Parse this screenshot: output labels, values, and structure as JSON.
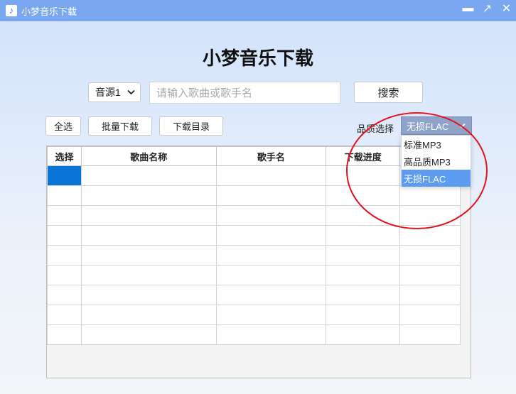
{
  "window": {
    "title": "小梦音乐下载",
    "controls": [
      "▬",
      "↗",
      "✕"
    ]
  },
  "heading": "小梦音乐下载",
  "search": {
    "source_selected": "音源1",
    "placeholder": "请输入歌曲或歌手名",
    "button": "搜索"
  },
  "toolbar": {
    "select_all": "全选",
    "batch_download": "批量下载",
    "download_dir": "下载目录",
    "quality_label": "品质选择",
    "quality_selected": "无损FLAC",
    "quality_options": [
      "标准MP3",
      "高品质MP3",
      "无损FLAC"
    ]
  },
  "table": {
    "columns": [
      "选择",
      "歌曲名称",
      "歌手名",
      "下载进度",
      ""
    ]
  },
  "colors": {
    "titlebar": "#7aa7f0",
    "accent": "#0b74d9",
    "annotation": "#e0141e"
  }
}
